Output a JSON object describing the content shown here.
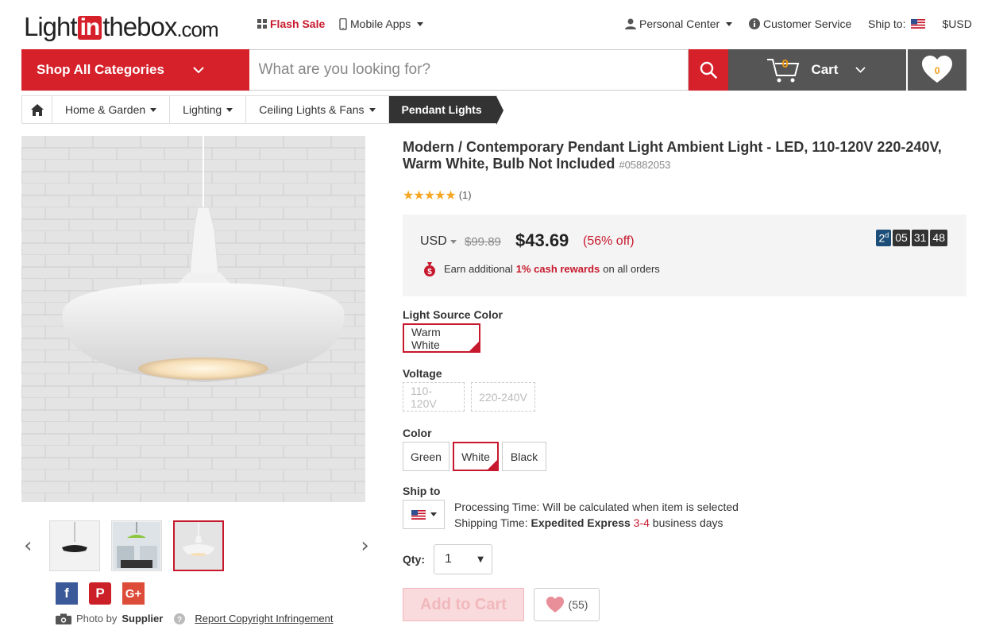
{
  "header": {
    "logo_left": "Light",
    "logo_in": "in",
    "logo_right": "thebox",
    "logo_com": ".com",
    "flash_sale": "Flash Sale",
    "mobile_apps": "Mobile Apps",
    "personal_center": "Personal Center",
    "customer_service": "Customer Service",
    "ship_to_label": "Ship to:",
    "currency": "$USD"
  },
  "search": {
    "shop_all": "Shop All Categories",
    "placeholder": "What are you looking for?",
    "cart_label": "Cart",
    "cart_count": "0",
    "wish_count": "0"
  },
  "breadcrumb": {
    "items": [
      "Home & Garden",
      "Lighting",
      "Ceiling Lights & Fans"
    ],
    "active": "Pendant Lights"
  },
  "product": {
    "title": "Modern / Contemporary Pendant Light Ambient Light - LED, 110-120V 220-240V, Warm White, Bulb Not Included",
    "sku": "#05882053",
    "stars": "★★★★★",
    "review_count": "(1)",
    "currency": "USD",
    "old_price": "$99.89",
    "price": "$43.69",
    "discount": "(56% off)",
    "cash_prefix": "Earn additional",
    "cash_highlight": "1% cash rewards",
    "cash_suffix": "on all orders",
    "timer": {
      "days": "2",
      "day_unit": "d",
      "hours": "05",
      "minutes": "31",
      "seconds": "48"
    }
  },
  "options": {
    "light_source_label": "Light Source Color",
    "light_source_values": [
      "Warm White"
    ],
    "voltage_label": "Voltage",
    "voltage_values": [
      "110-120V",
      "220-240V"
    ],
    "color_label": "Color",
    "color_values": [
      "Green",
      "White",
      "Black"
    ]
  },
  "shipping": {
    "label": "Ship to",
    "processing": "Processing Time: Will be calculated when item is selected",
    "shipping_prefix": "Shipping Time:",
    "method": "Expedited Express",
    "days": "3-4",
    "days_suffix": "business days"
  },
  "purchase": {
    "qty_label": "Qty:",
    "qty_value": "1",
    "add_to_cart": "Add to Cart",
    "wish_count": "(55)"
  },
  "footer_info": {
    "photo_by": "Photo by",
    "supplier": "Supplier",
    "report": "Report Copyright Infringement"
  },
  "colors": {
    "brand_red": "#d6202a",
    "dark": "#555555",
    "accent_orange": "#f39c12"
  }
}
